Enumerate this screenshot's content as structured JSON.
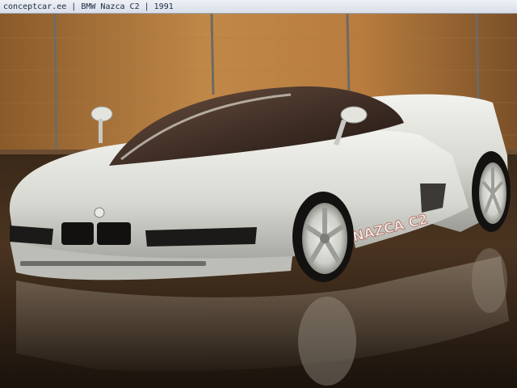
{
  "caption": {
    "site": "conceptcar.ee",
    "separator": " | ",
    "model": "BMW Nazca C2",
    "year": "1991"
  },
  "photo": {
    "subject": "car-photo",
    "badge_text": "NAZCA C2",
    "colors": {
      "wall": "#b47a3a",
      "car_body": "#dcdcd6",
      "ground": "#2a1d14",
      "glass": "#3a2a22"
    }
  }
}
